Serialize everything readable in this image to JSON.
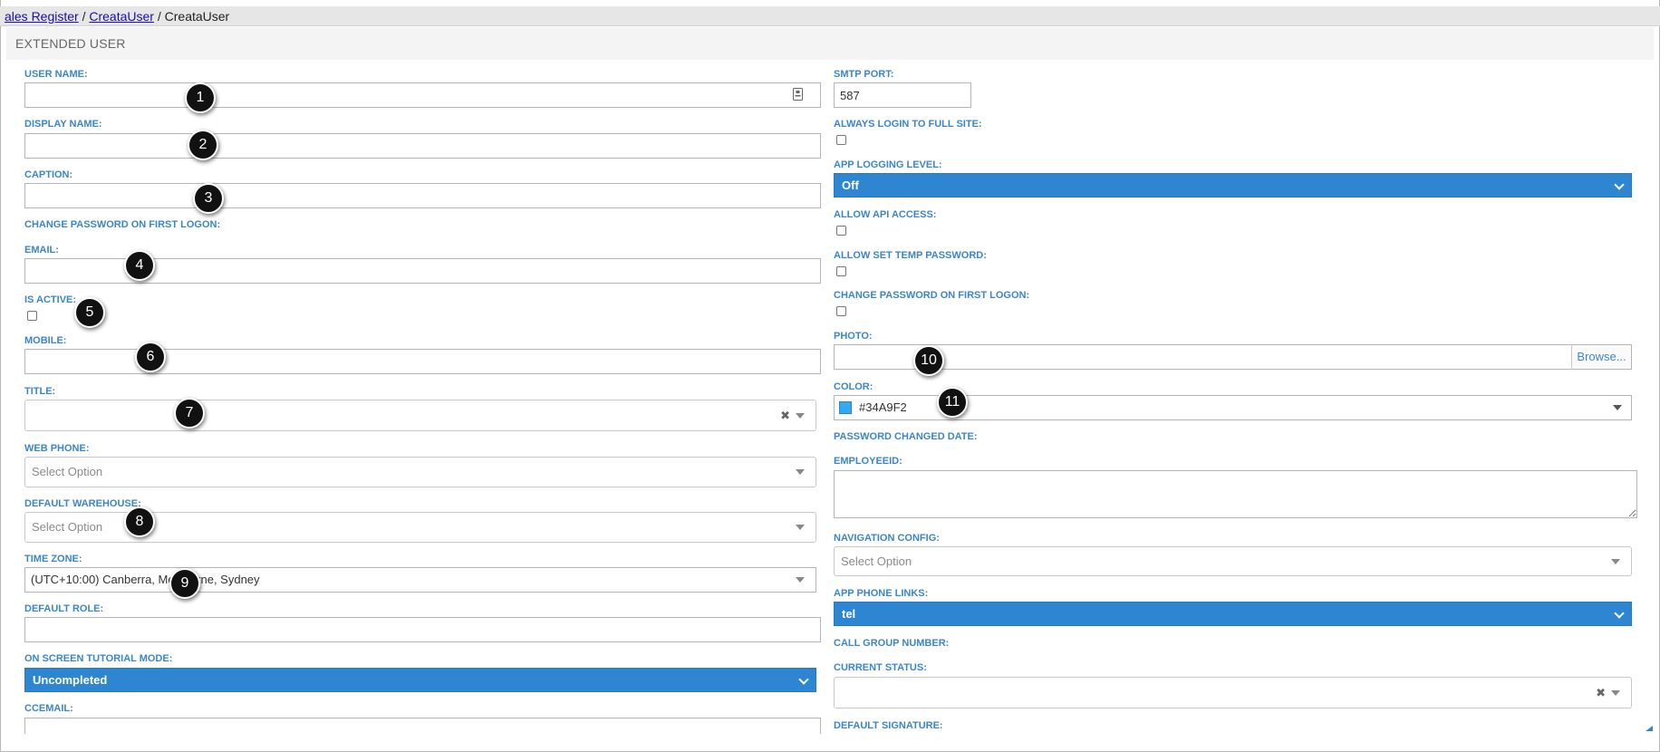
{
  "breadcrumb": {
    "item1": "ales Register",
    "sep1": " / ",
    "item2": "CreataUser",
    "sep2": " / ",
    "current": "CreataUser"
  },
  "panel": {
    "title": "EXTENDED USER"
  },
  "left": {
    "user_name": {
      "label": "USER NAME:",
      "value": ""
    },
    "display_name": {
      "label": "DISPLAY NAME:",
      "value": ""
    },
    "caption": {
      "label": "CAPTION:",
      "value": ""
    },
    "change_password_first_logon": {
      "label": "CHANGE PASSWORD ON FIRST LOGON:"
    },
    "email": {
      "label": "EMAIL:",
      "value": ""
    },
    "is_active": {
      "label": "IS ACTIVE:",
      "checked": false
    },
    "mobile": {
      "label": "MOBILE:",
      "value": ""
    },
    "title": {
      "label": "TITLE:",
      "value": ""
    },
    "web_phone": {
      "label": "WEB PHONE:",
      "placeholder": "Select Option"
    },
    "default_warehouse": {
      "label": "DEFAULT WAREHOUSE:",
      "placeholder": "Select Option"
    },
    "time_zone": {
      "label": "TIME ZONE:",
      "value": "(UTC+10:00) Canberra, Melbourne, Sydney"
    },
    "default_role": {
      "label": "DEFAULT ROLE:",
      "value": ""
    },
    "tutorial_mode": {
      "label": "ON SCREEN TUTORIAL MODE:",
      "value": "Uncompleted"
    },
    "ccemail": {
      "label": "CCEMAIL:",
      "value": ""
    }
  },
  "right": {
    "smtp_port": {
      "label": "SMTP PORT:",
      "value": "587"
    },
    "always_login_full_site": {
      "label": "ALWAYS LOGIN TO FULL SITE:",
      "checked": false
    },
    "app_logging_level": {
      "label": "APP LOGGING LEVEL:",
      "value": "Off"
    },
    "allow_api_access": {
      "label": "ALLOW API ACCESS:",
      "checked": false
    },
    "allow_set_temp_password": {
      "label": "ALLOW SET TEMP PASSWORD:",
      "checked": false
    },
    "change_password_first_logon": {
      "label": "CHANGE PASSWORD ON FIRST LOGON:",
      "checked": false
    },
    "photo": {
      "label": "PHOTO:",
      "browse": "Browse..."
    },
    "color": {
      "label": "COLOR:",
      "value": "#34A9F2",
      "swatch": "#34A9F2"
    },
    "password_changed_date": {
      "label": "PASSWORD CHANGED DATE:"
    },
    "employee_id": {
      "label": "EMPLOYEEID:",
      "value": ""
    },
    "navigation_config": {
      "label": "NAVIGATION CONFIG:",
      "placeholder": "Select Option"
    },
    "app_phone_links": {
      "label": "APP PHONE LINKS:",
      "value": "tel"
    },
    "call_group_number": {
      "label": "CALL GROUP NUMBER:"
    },
    "current_status": {
      "label": "CURRENT STATUS:",
      "value": ""
    },
    "default_signature": {
      "label": "DEFAULT SIGNATURE:"
    }
  },
  "icons": {
    "contact_card": "contact-card-icon",
    "clear": "✖",
    "dropdown": "caret-down-icon"
  },
  "callouts": [
    "1",
    "2",
    "3",
    "4",
    "5",
    "6",
    "7",
    "8",
    "9",
    "10",
    "11"
  ],
  "colors": {
    "label": "#3a86c8",
    "select_blue": "#2e86d3",
    "callout": "#111111"
  }
}
